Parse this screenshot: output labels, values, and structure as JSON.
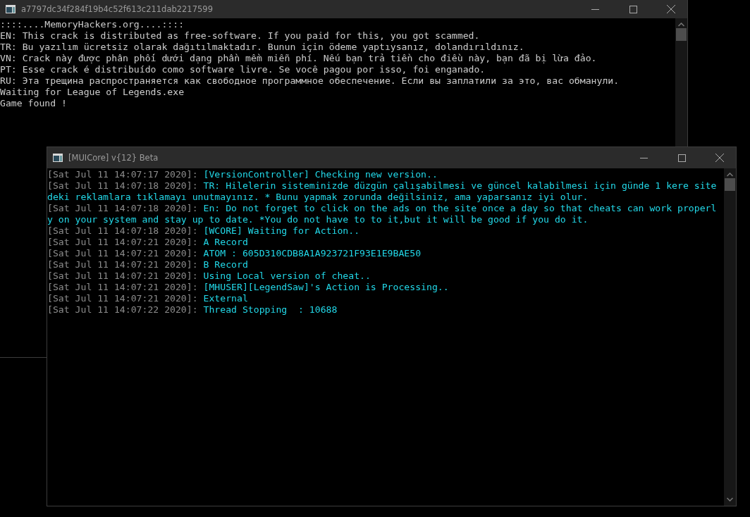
{
  "back_window": {
    "title": "a7797dc34f284f19b4c52f613c211dab2217599",
    "lines": [
      "::::....MemoryHackers.org....::::",
      "EN: This crack is distributed as free-software. If you paid for this, you got scammed.",
      "TR: Bu yazılım ücretsiz olarak dağıtılmaktadır. Bunun için ödeme yaptıysanız, dolandırıldınız.",
      "VN: Crack này được phân phối dưới dạng phần mềm miễn phí. Nếu bạn trả tiền cho điều này, bạn đã bị lừa đảo.",
      "PT: Esse crack é distribuído como software livre. Se você pagou por isso, foi enganado.",
      "RU: Эта трещина распространяется как свободное программное обеспечение. Если вы заплатили за это, вас обманули.",
      "Waiting for League of Legends.exe",
      "Game found !"
    ]
  },
  "front_window": {
    "title": "[MUICore] v{12} Beta",
    "log": [
      {
        "timestamp": "[Sat Jul 11 14:07:17 2020]:",
        "message": "[VersionController] Checking new version.."
      },
      {
        "timestamp": "[Sat Jul 11 14:07:18 2020]:",
        "message": "TR: Hilelerin sisteminizde düzgün çalışabilmesi ve güncel kalabilmesi için günde 1 kere sitedeki reklamlara tıklamayı unutmayınız. * Bunu yapmak zorunda değilsiniz, ama yaparsanız iyi olur."
      },
      {
        "timestamp": "[Sat Jul 11 14:07:18 2020]:",
        "message": "En: Do not forget to click on the ads on the site once a day so that cheats can work properly on your system and stay up to date. *You do not have to to it,but it will be good if you do it."
      },
      {
        "timestamp": "[Sat Jul 11 14:07:18 2020]:",
        "message": "[WCORE] Waiting for Action.."
      },
      {
        "timestamp": "[Sat Jul 11 14:07:21 2020]:",
        "message": "A Record"
      },
      {
        "timestamp": "[Sat Jul 11 14:07:21 2020]:",
        "message": "ATOM : 605D310CDB8A1A923721F93E1E9BAE50"
      },
      {
        "timestamp": "[Sat Jul 11 14:07:21 2020]:",
        "message": "B Record"
      },
      {
        "timestamp": "[Sat Jul 11 14:07:21 2020]:",
        "message": "Using Local version of cheat.."
      },
      {
        "timestamp": "[Sat Jul 11 14:07:21 2020]:",
        "message": "[MHUSER][LegendSaw]'s Action is Processing.."
      },
      {
        "timestamp": "[Sat Jul 11 14:07:21 2020]:",
        "message": "External"
      },
      {
        "timestamp": "[Sat Jul 11 14:07:22 2020]:",
        "message": "Thread Stopping  : 10688"
      }
    ]
  }
}
